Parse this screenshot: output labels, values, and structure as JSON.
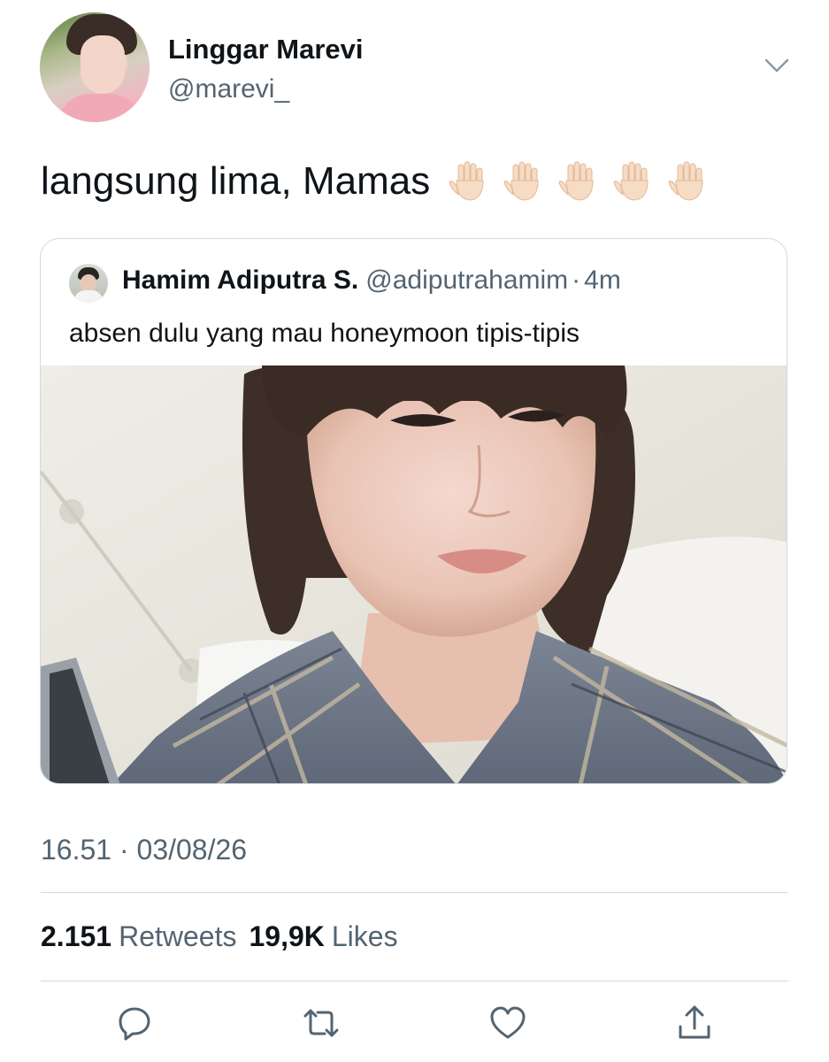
{
  "author": {
    "name": "Linggar Marevi",
    "handle": "@marevi_"
  },
  "tweet": {
    "text": "langsung lima, Mamas",
    "emoji_icons": [
      "raised-hand-icon",
      "raised-hand-icon",
      "raised-hand-icon",
      "raised-hand-icon",
      "raised-hand-icon"
    ]
  },
  "quoted": {
    "name": "Hamim Adiputra S.",
    "handle": "@adiputrahamim",
    "separator": "·",
    "time": "4m",
    "text": "absen dulu yang mau honeymoon tipis-tipis"
  },
  "meta": {
    "timestamp": "16.51 · 03/08/26"
  },
  "stats": {
    "retweets_count": "2.151",
    "retweets_label": "Retweets",
    "likes_count": "19,9K",
    "likes_label": "Likes"
  },
  "actions": {
    "icons": [
      "reply-icon",
      "retweet-icon",
      "like-icon",
      "share-icon"
    ]
  },
  "colors": {
    "text_primary": "#0f1419",
    "text_secondary": "#536471",
    "border": "#cfd9de",
    "icon": "#536471"
  }
}
